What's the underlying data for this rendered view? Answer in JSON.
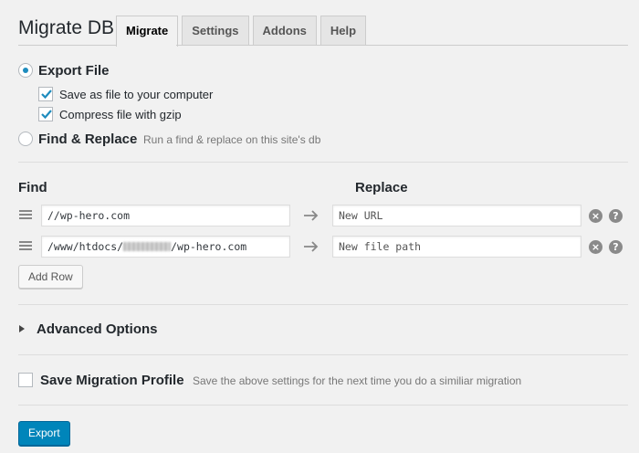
{
  "header": {
    "title": "Migrate DB",
    "tabs": [
      {
        "label": "Migrate",
        "active": true
      },
      {
        "label": "Settings",
        "active": false
      },
      {
        "label": "Addons",
        "active": false
      },
      {
        "label": "Help",
        "active": false
      }
    ]
  },
  "options": {
    "export_file": {
      "label": "Export File",
      "selected": true
    },
    "save_as_file": {
      "label": "Save as file to your computer",
      "checked": true
    },
    "compress": {
      "label": "Compress file with gzip",
      "checked": true
    },
    "find_replace": {
      "label": "Find & Replace",
      "hint": "Run a find & replace on this site's db",
      "selected": false
    }
  },
  "find_replace": {
    "find_heading": "Find",
    "replace_heading": "Replace",
    "rows": [
      {
        "find_value": "//wp-hero.com",
        "replace_placeholder": "New URL"
      },
      {
        "find_prefix": "/www/htdocs/",
        "find_suffix": "/wp-hero.com",
        "replace_placeholder": "New file path"
      }
    ],
    "add_row_label": "Add Row"
  },
  "advanced": {
    "label": "Advanced Options"
  },
  "profile": {
    "label": "Save Migration Profile",
    "hint": "Save the above settings for the next time you do a similiar migration",
    "checked": false
  },
  "export_button": "Export",
  "colors": {
    "accent": "#0085ba",
    "radio_dot": "#1e8cbe",
    "checkmark": "#1e8cbe"
  },
  "icons": [
    "drag-handle-icon",
    "arrow-right-icon",
    "remove-icon",
    "help-icon",
    "checkmark-icon",
    "triangle-right-icon"
  ]
}
